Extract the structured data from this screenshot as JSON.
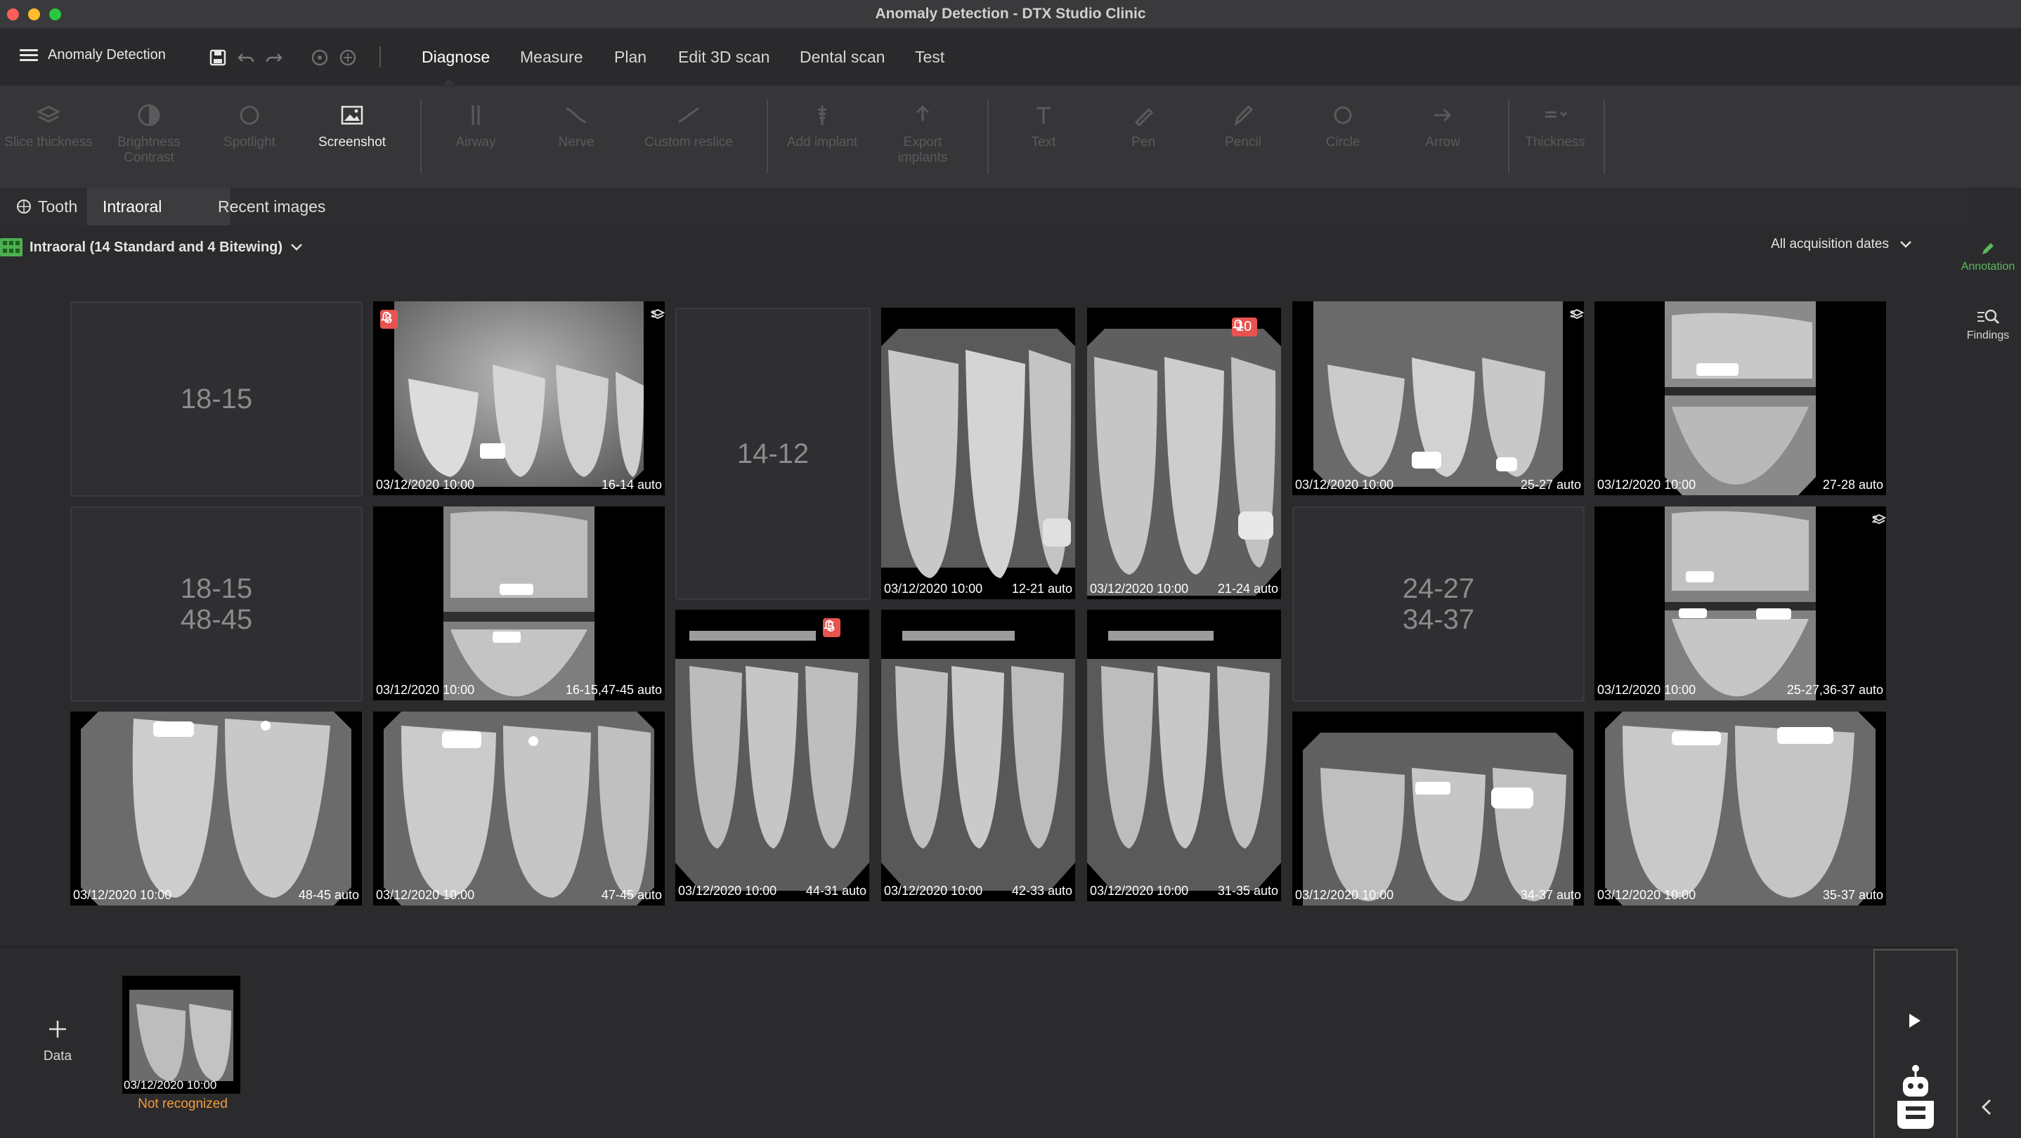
{
  "window": {
    "title": "Anomaly Detection - DTX Studio Clinic"
  },
  "menubar": {
    "app_label": "Anomaly Detection",
    "tabs": [
      "Diagnose",
      "Measure",
      "Plan",
      "Edit 3D scan",
      "Dental scan",
      "Test"
    ],
    "active_tab": "Diagnose"
  },
  "toolbar": {
    "tools": [
      {
        "label": "Slice thickness",
        "icon": "layers-icon",
        "enabled": false
      },
      {
        "label": "Brightness Contrast",
        "icon": "contrast-icon",
        "enabled": false
      },
      {
        "label": "Spotlight",
        "icon": "spotlight-icon",
        "enabled": false
      },
      {
        "label": "Screenshot",
        "icon": "screenshot-icon",
        "enabled": true
      },
      {
        "label": "Airway",
        "icon": "airway-icon",
        "enabled": false
      },
      {
        "label": "Nerve",
        "icon": "nerve-icon",
        "enabled": false
      },
      {
        "label": "Custom reslice",
        "icon": "reslice-icon",
        "enabled": false
      },
      {
        "label": "Add implant",
        "icon": "implant-icon",
        "enabled": false
      },
      {
        "label": "Export implants",
        "icon": "export-icon",
        "enabled": false
      },
      {
        "label": "Text",
        "icon": "text-icon",
        "enabled": false
      },
      {
        "label": "Pen",
        "icon": "pen-icon",
        "enabled": false
      },
      {
        "label": "Pencil",
        "icon": "pencil-icon",
        "enabled": false
      },
      {
        "label": "Circle",
        "icon": "circle-icon",
        "enabled": false
      },
      {
        "label": "Arrow",
        "icon": "arrow-icon",
        "enabled": false
      },
      {
        "label": "Thickness",
        "icon": "thickness-icon",
        "enabled": false
      }
    ]
  },
  "tabs": {
    "tooth": "Tooth",
    "intraoral": "Intraoral",
    "recent": "Recent images"
  },
  "group": {
    "label": "Intraoral (14 Standard and 4 Bitewing)",
    "dates_filter": "All acquisition dates"
  },
  "slots": {
    "s1815": "18-15",
    "s1815b_top": "18-15",
    "s1815b_bot": "48-45",
    "s1412": "14-12",
    "s2427_top": "24-27",
    "s2427_bot": "34-37"
  },
  "images": {
    "i1614": {
      "date": "03/12/2020 10:00",
      "region": "16-14 auto",
      "alerts": "8",
      "stack": "3"
    },
    "i1221": {
      "date": "03/12/2020 10:00",
      "region": "12-21 auto"
    },
    "i2124": {
      "date": "03/12/2020 10:00",
      "region": "21-24 auto",
      "alerts": "10"
    },
    "i2527": {
      "date": "03/12/2020 10:00",
      "region": "25-27 auto",
      "stack": "3"
    },
    "i2728": {
      "date": "03/12/2020 10:00",
      "region": "27-28 auto"
    },
    "i1615": {
      "date": "03/12/2020 10:00",
      "region": "16-15,47-45 auto"
    },
    "i4431": {
      "date": "03/12/2020 10:00",
      "region": "44-31 auto",
      "alerts": "5"
    },
    "i4233": {
      "date": "03/12/2020 10:00",
      "region": "42-33 auto"
    },
    "i3135": {
      "date": "03/12/2020 10:00",
      "region": "31-35 auto"
    },
    "i2527b": {
      "date": "03/12/2020 10:00",
      "region": "25-27,36-37 auto",
      "stack": "2"
    },
    "i4845": {
      "date": "03/12/2020 10:00",
      "region": "48-45 auto"
    },
    "i4745": {
      "date": "03/12/2020 10:00",
      "region": "47-45 auto"
    },
    "i3437": {
      "date": "03/12/2020 10:00",
      "region": "34-37 auto"
    },
    "i3537": {
      "date": "03/12/2020 10:00",
      "region": "35-37 auto"
    }
  },
  "sidebar": {
    "annotation": "Annotation",
    "findings": "Findings"
  },
  "bottom": {
    "add_label": "Data",
    "unrecognized": {
      "date": "03/12/2020 10:00",
      "status": "Not recognized"
    }
  },
  "colors": {
    "accent_green": "#5cb85c",
    "alert_red": "#e8534f",
    "warning_orange": "#f39c3d"
  }
}
